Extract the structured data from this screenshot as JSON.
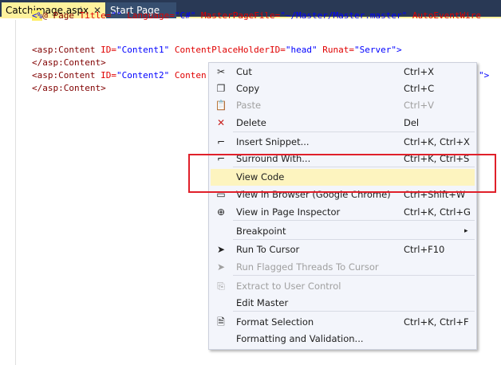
{
  "tabs": [
    {
      "label": "Catchimage.aspx",
      "pin": "⊣",
      "close": "✕"
    },
    {
      "label": "Start Page"
    }
  ],
  "code": {
    "l1": {
      "open": "<%",
      "at": "@ Page ",
      "a1": "Title=",
      "v1": "\"\"",
      "a2": " Language=",
      "v2": "\"C#\"",
      "a3": " MasterPageFile=",
      "v3": "\"~/Master/Master.master\"",
      "a4": " AutoEventWire"
    },
    "l2": {
      "tag": "<asp:Content ",
      "a1": "ID=",
      "v1": "\"Content1\"",
      "a2": " ContentPlaceHolderID=",
      "v2": "\"head\"",
      "a3": " Runat=",
      "v3": "\"Server\"",
      "end": ">"
    },
    "l3": "</asp:Content>",
    "l4": {
      "tag": "<asp:Content ",
      "a1": "ID=",
      "v1": "\"Content2\"",
      "a2": " Conten"
    },
    "l4_tail": "\">",
    "l5": "</asp:Content>"
  },
  "menu": [
    {
      "icon": "✂",
      "label": "Cut",
      "shortcut": "Ctrl+X"
    },
    {
      "icon": "❐",
      "label": "Copy",
      "shortcut": "Ctrl+C"
    },
    {
      "icon": "📋",
      "label": "Paste",
      "shortcut": "Ctrl+V",
      "disabled": true
    },
    {
      "icon": "✕",
      "label": "Delete",
      "shortcut": "Del"
    },
    {
      "icon": "⌐",
      "label": "Insert Snippet...",
      "shortcut": "Ctrl+K, Ctrl+X"
    },
    {
      "icon": "⌐",
      "label": "Surround With...",
      "shortcut": "Ctrl+K, Ctrl+S"
    },
    {
      "label": "View Code",
      "highlighted": true
    },
    {
      "icon": "▭",
      "label": "View in Browser (Google Chrome)",
      "shortcut": "Ctrl+Shift+W"
    },
    {
      "icon": "⊕",
      "label": "View in Page Inspector",
      "shortcut": "Ctrl+K, Ctrl+G"
    },
    {
      "label": "Breakpoint",
      "submenu": "▸"
    },
    {
      "icon": "➤",
      "label": "Run To Cursor",
      "shortcut": "Ctrl+F10"
    },
    {
      "icon": "➤",
      "label": "Run Flagged Threads To Cursor",
      "disabled": true
    },
    {
      "icon": "⎘",
      "label": "Extract to User Control",
      "disabled": true
    },
    {
      "label": "Edit Master"
    },
    {
      "icon": "🗎",
      "label": "Format Selection",
      "shortcut": "Ctrl+K, Ctrl+F"
    },
    {
      "label": "Formatting and Validation..."
    }
  ],
  "colors": {
    "highlight_box": "#e0202a",
    "active_tab": "#fff29d"
  }
}
